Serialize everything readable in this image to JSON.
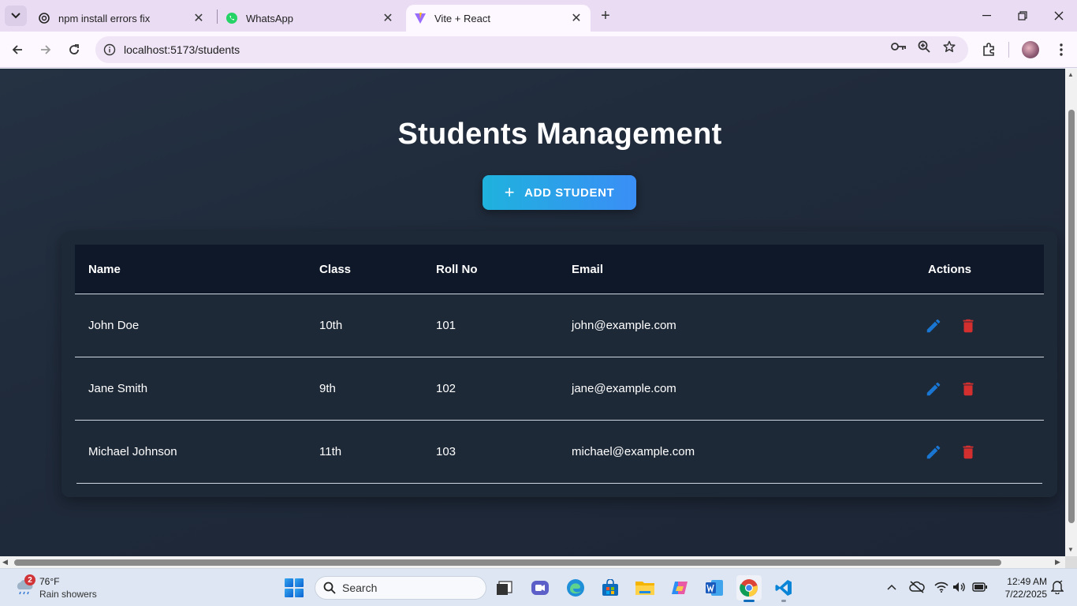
{
  "browser": {
    "tabs": [
      {
        "title": "npm install errors fix",
        "icon": "chatgpt-icon"
      },
      {
        "title": "WhatsApp",
        "icon": "whatsapp-icon"
      },
      {
        "title": "Vite + React",
        "icon": "vite-icon",
        "active": true
      }
    ],
    "url": "localhost:5173/students"
  },
  "page": {
    "title": "Students Management",
    "add_button_label": "ADD STUDENT",
    "columns": [
      "Name",
      "Class",
      "Roll No",
      "Email",
      "Actions"
    ],
    "students": [
      {
        "name": "John Doe",
        "class": "10th",
        "roll": "101",
        "email": "john@example.com"
      },
      {
        "name": "Jane Smith",
        "class": "9th",
        "roll": "102",
        "email": "jane@example.com"
      },
      {
        "name": "Michael Johnson",
        "class": "11th",
        "roll": "103",
        "email": "michael@example.com"
      }
    ],
    "colors": {
      "edit": "#1976d2",
      "delete": "#d32f2f",
      "accent_start": "#1fb2dd",
      "accent_end": "#3a8ef6"
    }
  },
  "taskbar": {
    "weather": {
      "badge": "2",
      "temp": "76°F",
      "desc": "Rain showers"
    },
    "search_placeholder": "Search",
    "time": "12:49 AM",
    "date": "7/22/2025"
  }
}
